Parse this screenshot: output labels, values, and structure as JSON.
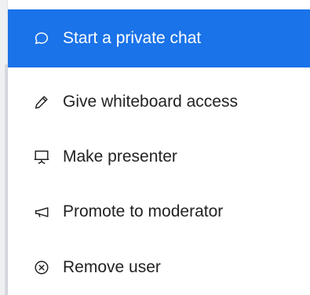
{
  "menu": {
    "items": [
      {
        "label": "Start a private chat",
        "icon": "chat-bubble-icon",
        "active": true
      },
      {
        "label": "Give whiteboard access",
        "icon": "pencil-icon",
        "active": false
      },
      {
        "label": "Make presenter",
        "icon": "presentation-screen-icon",
        "active": false
      },
      {
        "label": "Promote to moderator",
        "icon": "megaphone-icon",
        "active": false
      },
      {
        "label": "Remove user",
        "icon": "close-circle-icon",
        "active": false
      }
    ]
  },
  "colors": {
    "active_background": "#1a73e8",
    "active_text": "#ffffff",
    "text": "#222222"
  }
}
